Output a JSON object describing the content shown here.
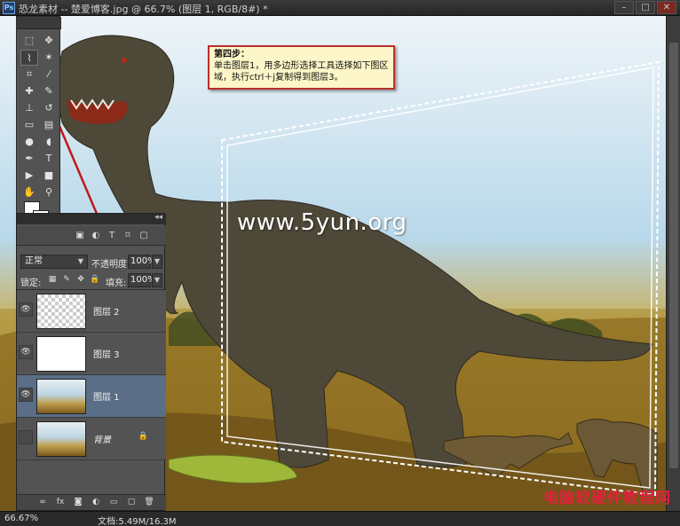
{
  "window": {
    "app_badge": "Ps",
    "title": "恐龙素材 -- 楚爱博客.jpg @ 66.7% (图层 1, RGB/8#) *",
    "buttons": [
      "–",
      "□",
      "✕"
    ]
  },
  "annotation": {
    "title": "第四步：",
    "body": "单击图层1，用多边形选择工具选择如下图区域，执行ctrl＋j复制得到图层3。"
  },
  "canvas_watermark": "www.5yun.org",
  "status": {
    "zoom": "66.67%",
    "doc": "文档:5.49M/16.3M"
  },
  "corner_watermark": "电脑软硬件教程网",
  "toolbox": {
    "tools": [
      {
        "icon": "marquee-icon",
        "glyph": "⬚"
      },
      {
        "icon": "move-icon",
        "glyph": "✥"
      },
      {
        "icon": "polygonal-lasso-icon",
        "glyph": "⌇"
      },
      {
        "icon": "magic-wand-icon",
        "glyph": "✶"
      },
      {
        "icon": "crop-icon",
        "glyph": "⌗"
      },
      {
        "icon": "eyedropper-icon",
        "glyph": "⁄"
      },
      {
        "icon": "healing-brush-icon",
        "glyph": "✚"
      },
      {
        "icon": "brush-icon",
        "glyph": "✎"
      },
      {
        "icon": "clone-stamp-icon",
        "glyph": "⊥"
      },
      {
        "icon": "history-brush-icon",
        "glyph": "↺"
      },
      {
        "icon": "eraser-icon",
        "glyph": "▭"
      },
      {
        "icon": "gradient-icon",
        "glyph": "▤"
      },
      {
        "icon": "blur-icon",
        "glyph": "●"
      },
      {
        "icon": "dodge-icon",
        "glyph": "◖"
      },
      {
        "icon": "pen-icon",
        "glyph": "✒"
      },
      {
        "icon": "type-icon",
        "glyph": "T"
      },
      {
        "icon": "path-selection-icon",
        "glyph": "▶"
      },
      {
        "icon": "shape-icon",
        "glyph": "■"
      },
      {
        "icon": "hand-icon",
        "glyph": "✋"
      },
      {
        "icon": "zoom-icon",
        "glyph": "⚲"
      }
    ]
  },
  "layers_panel": {
    "filter_icons": [
      "image-filter-icon",
      "adjustment-filter-icon",
      "type-filter-icon",
      "shape-filter-icon",
      "smart-object-filter-icon"
    ],
    "filter_glyphs": [
      "▣",
      "◐",
      "T",
      "⌑",
      "▢"
    ],
    "blend_mode": "正常",
    "opacity_label": "不透明度:",
    "opacity_value": "100%",
    "lock_label": "锁定:",
    "fill_label": "填充:",
    "fill_value": "100%",
    "lock_glyphs": [
      "▦",
      "✎",
      "✥",
      "🔒"
    ],
    "layers": [
      {
        "name": "图层 2",
        "visible": true,
        "selected": false,
        "thumb": "transparent"
      },
      {
        "name": "图层 3",
        "visible": true,
        "selected": false,
        "thumb": "cut"
      },
      {
        "name": "图层 1",
        "visible": true,
        "selected": true,
        "thumb": "img"
      },
      {
        "name": "背景",
        "visible": false,
        "selected": false,
        "thumb": "img",
        "locked": true
      }
    ],
    "footer_glyphs": [
      "∞",
      "fx",
      "◙",
      "◐",
      "▭",
      "▢",
      "🗑"
    ]
  },
  "colors": {
    "accent_red": "#b8302e",
    "callout_bg": "#fdf6c8",
    "selected_layer": "#5a6e87",
    "watermark_red": "#e0223a"
  }
}
